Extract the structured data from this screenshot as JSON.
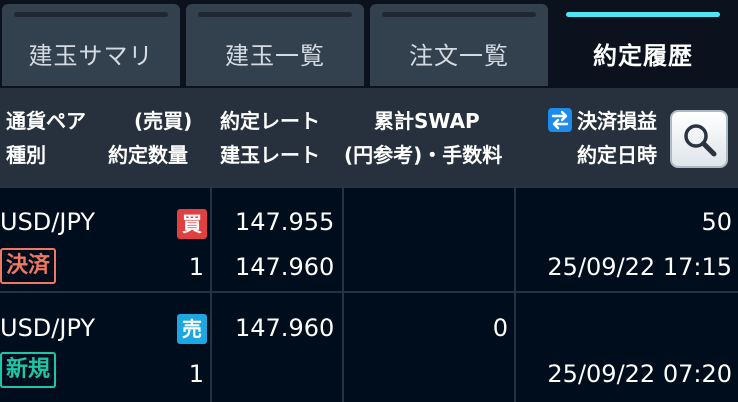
{
  "tabs": [
    {
      "label": "建玉サマリ",
      "active": false
    },
    {
      "label": "建玉一覧",
      "active": false
    },
    {
      "label": "注文一覧",
      "active": false
    },
    {
      "label": "約定履歴",
      "active": true
    }
  ],
  "header": {
    "col1_line1": "通貨ペア",
    "col1_line1_side": "(売買)",
    "col1_line2": "種別",
    "col1_line2_side": "約定数量",
    "col2_line1": "約定レート",
    "col2_line2": "建玉レート",
    "col3_line1": "累計SWAP",
    "col3_line2": "(円参考)・手数料",
    "col4_line1": "決済損益",
    "col4_line2": "約定日時",
    "sort_icon": "swap-arrows-icon",
    "search_icon": "magnifier-icon"
  },
  "trades": [
    {
      "pair": "USD/JPY",
      "side": "買",
      "side_color": "#e0403f",
      "type": "決済",
      "type_color": "#f07860",
      "qty": "1",
      "exec_rate": "147.955",
      "position_rate": "147.960",
      "swap": "",
      "pnl": "50",
      "datetime": "25/09/22 17:15"
    },
    {
      "pair": "USD/JPY",
      "side": "売",
      "side_color": "#1ca7e0",
      "type": "新規",
      "type_color": "#1ec7a3",
      "qty": "1",
      "exec_rate": "147.960",
      "position_rate": "",
      "swap": "0",
      "pnl": "",
      "datetime": "25/09/22 07:20"
    }
  ]
}
